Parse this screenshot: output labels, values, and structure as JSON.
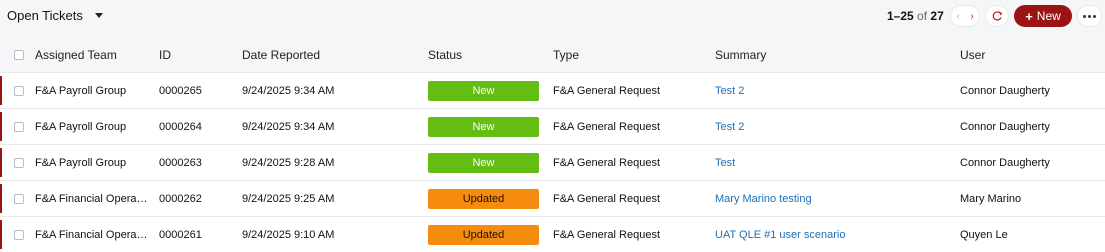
{
  "toolbar": {
    "view_label": "Open Tickets",
    "paging": {
      "range": "1–25",
      "of": "of",
      "total": "27"
    },
    "prev": "‹",
    "next": "›",
    "new_label": "New",
    "plus": "+",
    "colors": {
      "brand": "#9b1414"
    }
  },
  "columns": {
    "team": "Assigned Team",
    "id": "ID",
    "date": "Date Reported",
    "status": "Status",
    "type": "Type",
    "summary": "Summary",
    "user": "User"
  },
  "rows": [
    {
      "team": "F&A Payroll Group",
      "id": "0000265",
      "date": "9/24/2025 9:34 AM",
      "status": "New",
      "type": "F&A General Request",
      "summary": "Test 2",
      "user": "Connor Daugherty"
    },
    {
      "team": "F&A Payroll Group",
      "id": "0000264",
      "date": "9/24/2025 9:34 AM",
      "status": "New",
      "type": "F&A General Request",
      "summary": "Test 2",
      "user": "Connor Daugherty"
    },
    {
      "team": "F&A Payroll Group",
      "id": "0000263",
      "date": "9/24/2025 9:28 AM",
      "status": "New",
      "type": "F&A General Request",
      "summary": "Test",
      "user": "Connor Daugherty"
    },
    {
      "team": "F&A Financial Operations",
      "id": "0000262",
      "date": "9/24/2025 9:25 AM",
      "status": "Updated",
      "type": "F&A General Request",
      "summary": "Mary Marino testing",
      "user": "Mary Marino"
    },
    {
      "team": "F&A Financial Operations",
      "id": "0000261",
      "date": "9/24/2025 9:10 AM",
      "status": "Updated",
      "type": "F&A General Request",
      "summary": "UAT QLE #1 user scenario",
      "user": "Quyen Le"
    }
  ],
  "status_colors": {
    "New": "#64bd12",
    "Updated": "#f68c0f"
  }
}
